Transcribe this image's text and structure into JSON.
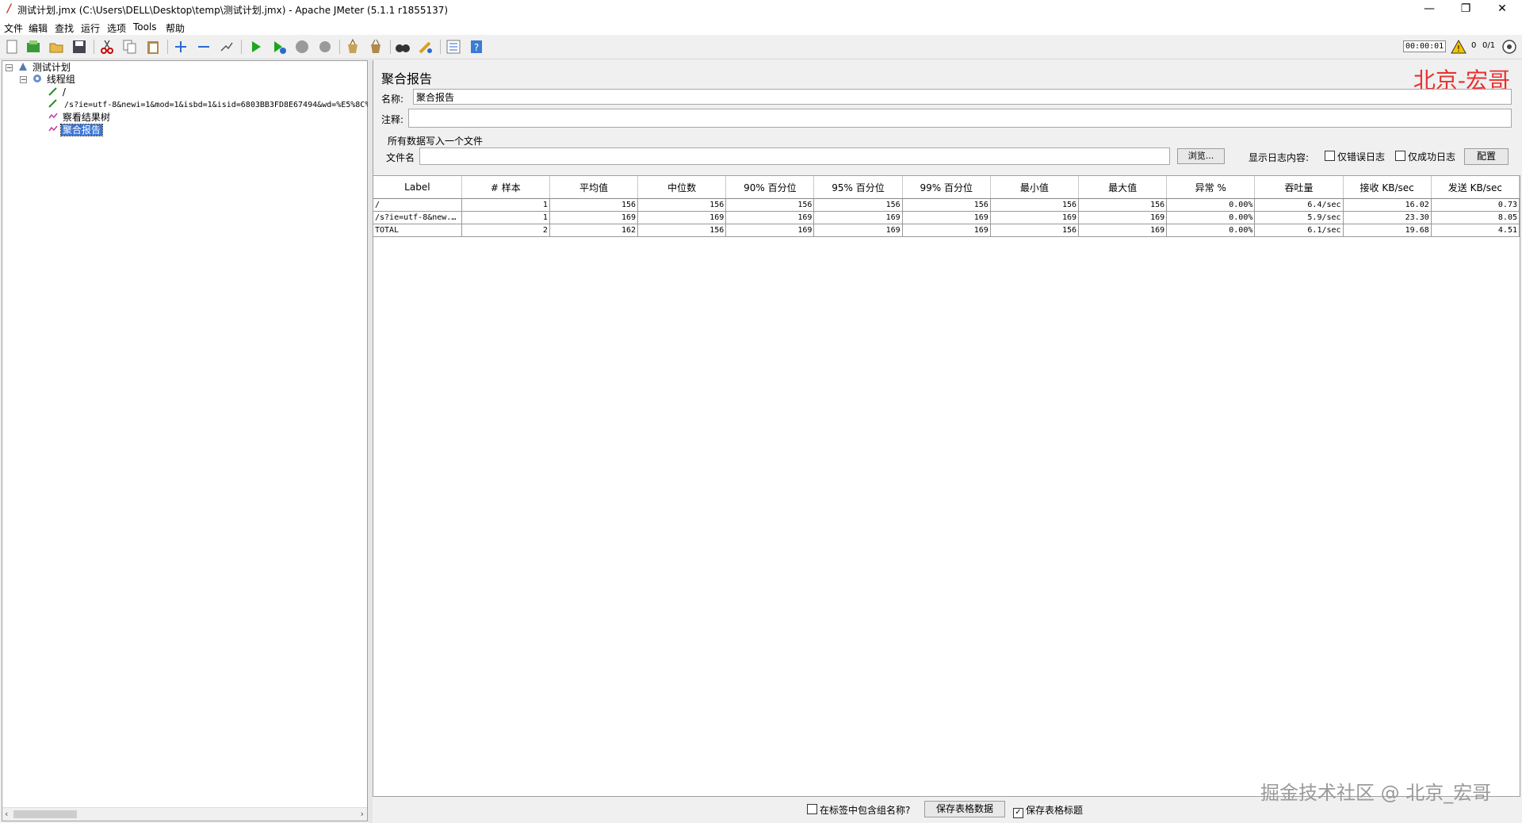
{
  "window": {
    "title": "测试计划.jmx (C:\\Users\\DELL\\Desktop\\temp\\测试计划.jmx) - Apache JMeter (5.1.1 r1855137)",
    "minimize_glyph": "—",
    "restore_glyph": "❐",
    "close_glyph": "✕"
  },
  "menu": [
    "文件",
    "编辑",
    "查找",
    "运行",
    "选项",
    "Tools",
    "帮助"
  ],
  "toolbar": {
    "timer": "00:00:01",
    "warning_count": "0",
    "thread_count": "0/1",
    "icons": [
      "new-icon",
      "templates-icon",
      "open-icon",
      "save-icon",
      "cut-icon",
      "copy-icon",
      "paste-icon",
      "expand-icon",
      "collapse-icon",
      "toggle-icon",
      "start-icon",
      "start-no-pause-icon",
      "stop-icon",
      "shutdown-icon",
      "clear-icon",
      "clear-all-icon",
      "search-icon",
      "reset-search-icon",
      "function-helper-icon",
      "help-icon",
      "warning-icon",
      "remote-icon"
    ]
  },
  "tree": {
    "nodes": [
      {
        "label": "测试计划"
      },
      {
        "label": "线程组"
      },
      {
        "label": "/"
      },
      {
        "label": "/s?ie=utf-8&newi=1&mod=1&isbd=1&isid=6803BB3FD8E67494&wd=%E5%8C%"
      },
      {
        "label": "察看结果树"
      },
      {
        "label": "聚合报告"
      }
    ]
  },
  "panel": {
    "title": "聚合报告",
    "brand": "北京-宏哥",
    "name_label": "名称:",
    "name_value": "聚合报告",
    "comment_label": "注释:",
    "comment_value": "",
    "file_section": "所有数据写入一个文件",
    "filename_label": "文件名",
    "filename_value": "",
    "browse_label": "浏览...",
    "log_label": "显示日志内容:",
    "errors_only_label": "仅错误日志",
    "success_only_label": "仅成功日志",
    "configure_label": "配置"
  },
  "table": {
    "columns": [
      "Label",
      "# 样本",
      "平均值",
      "中位数",
      "90% 百分位",
      "95% 百分位",
      "99% 百分位",
      "最小值",
      "最大值",
      "异常 %",
      "吞吐量",
      "接收 KB/sec",
      "发送 KB/sec"
    ],
    "rows": [
      [
        "/",
        "1",
        "156",
        "156",
        "156",
        "156",
        "156",
        "156",
        "156",
        "0.00%",
        "6.4/sec",
        "16.02",
        "0.73"
      ],
      [
        "/s?ie=utf-8&new...",
        "1",
        "169",
        "169",
        "169",
        "169",
        "169",
        "169",
        "169",
        "0.00%",
        "5.9/sec",
        "23.30",
        "8.05"
      ],
      [
        "TOTAL",
        "2",
        "162",
        "156",
        "169",
        "169",
        "169",
        "156",
        "169",
        "0.00%",
        "6.1/sec",
        "19.68",
        "4.51"
      ]
    ]
  },
  "bottom": {
    "include_group_label": "在标签中包含组名称?",
    "save_table_label": "保存表格数据",
    "save_header_label": "保存表格标题",
    "save_header_checked": "✓"
  },
  "watermark": "掘金技术社区 @ 北京_宏哥"
}
